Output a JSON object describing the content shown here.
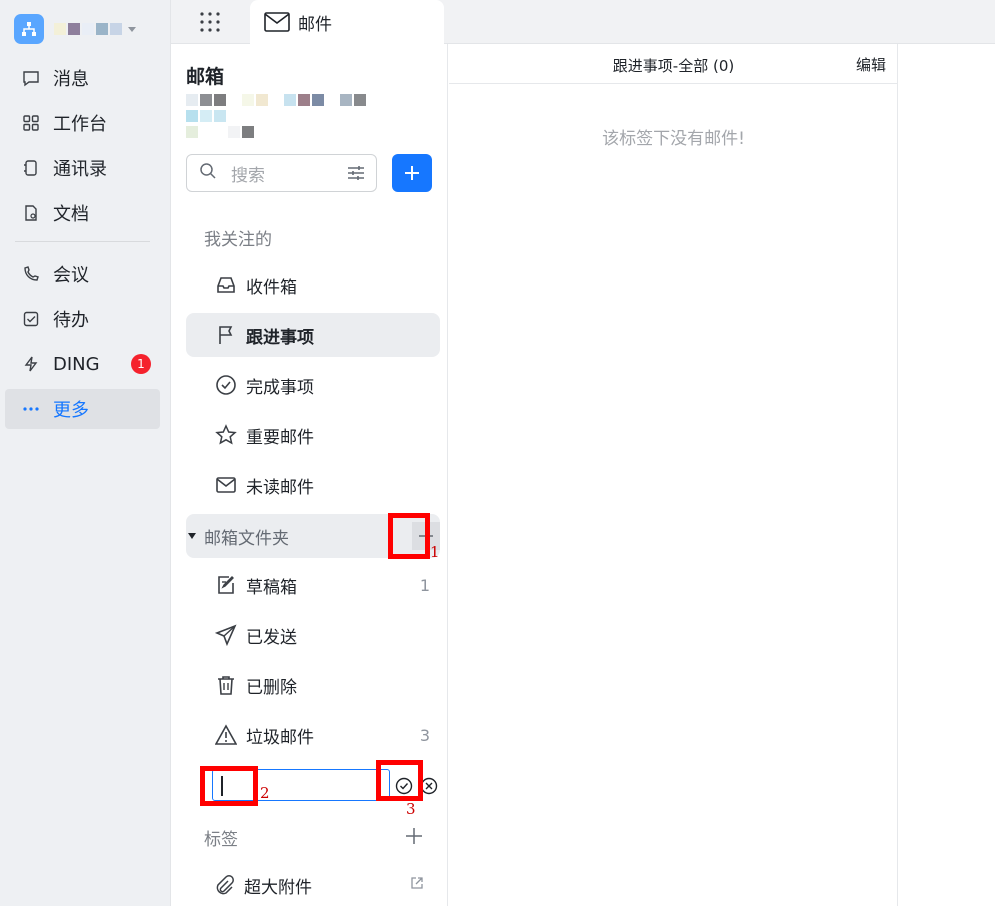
{
  "nav": {
    "items": [
      {
        "label": "消息",
        "icon": "chat-icon"
      },
      {
        "label": "工作台",
        "icon": "apps-icon"
      },
      {
        "label": "通讯录",
        "icon": "contacts-icon"
      },
      {
        "label": "文档",
        "icon": "document-icon"
      },
      {
        "label": "会议",
        "icon": "phone-icon"
      },
      {
        "label": "待办",
        "icon": "checkbox-icon"
      },
      {
        "label": "DING",
        "icon": "lightning-icon",
        "badge": "1"
      },
      {
        "label": "更多",
        "icon": "more-icon"
      }
    ],
    "accent": "#1677ff"
  },
  "topbar": {
    "tab_label": "邮件"
  },
  "mail": {
    "title": "邮箱",
    "search_placeholder": "搜索",
    "section_followed": "我关注的",
    "followed": [
      {
        "label": "收件箱",
        "icon": "inbox-icon"
      },
      {
        "label": "跟进事项",
        "icon": "flag-icon"
      },
      {
        "label": "完成事项",
        "icon": "check-circle-icon"
      },
      {
        "label": "重要邮件",
        "icon": "star-icon"
      },
      {
        "label": "未读邮件",
        "icon": "mail-icon"
      }
    ],
    "section_folders": "邮箱文件夹",
    "folders": [
      {
        "label": "草稿箱",
        "icon": "draft-icon",
        "count": "1"
      },
      {
        "label": "已发送",
        "icon": "send-icon",
        "count": ""
      },
      {
        "label": "已删除",
        "icon": "trash-icon",
        "count": ""
      },
      {
        "label": "垃圾邮件",
        "icon": "warning-icon",
        "count": "3"
      }
    ],
    "section_tags": "标签",
    "attachment_label": "超大附件"
  },
  "annotations": [
    "1",
    "2",
    "3"
  ],
  "main": {
    "header_title": "跟进事项-全部 (0)",
    "edit_label": "编辑",
    "empty_text": "该标签下没有邮件!"
  }
}
